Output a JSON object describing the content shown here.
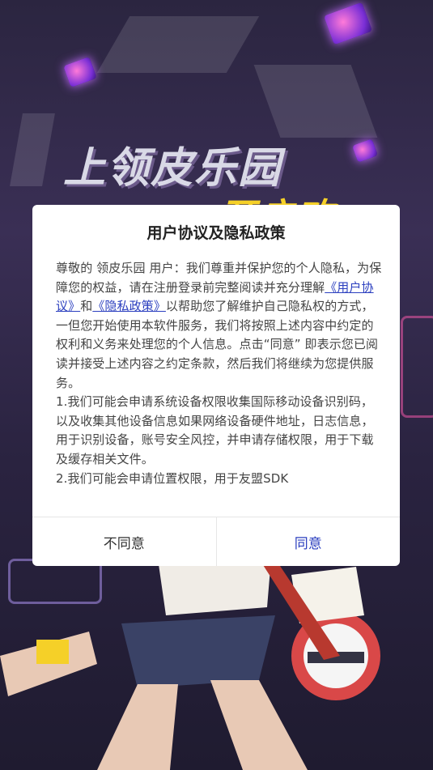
{
  "background": {
    "title_art": "上领皮乐园",
    "title_art_partial": "开启欢"
  },
  "dialog": {
    "title": "用户协议及隐私政策",
    "para1_pre": "尊敬的 领皮乐园 用户：我们尊重并保护您的个人隐私，为保障您的权益，请在注册登录前完整阅读并充分理解",
    "link_user_agreement": "《用户协议》",
    "para1_and": "和",
    "link_privacy_policy": "《隐私政策》",
    "para1_post": "以帮助您了解维护自己隐私权的方式，一但您开始使用本软件服务，我们将按照上述内容中约定的权利和义务来处理您的个人信息。点击“同意” 即表示您已阅读并接受上述内容之约定条款，然后我们将继续为您提供服务。",
    "item1": "1.我们可能会申请系统设备权限收集国际移动设备识别码，以及收集其他设备信息如果网络设备硬件地址，日志信息，用于识别设备，账号安全风控，并申请存储权限，用于下载及缓存相关文件。",
    "item2": "2.我们可能会申请位置权限，用于友盟SDK",
    "disagree_label": "不同意",
    "agree_label": "同意"
  },
  "colors": {
    "link": "#2b3fbf",
    "dialog_bg": "#ffffff",
    "title_text": "#222222"
  }
}
